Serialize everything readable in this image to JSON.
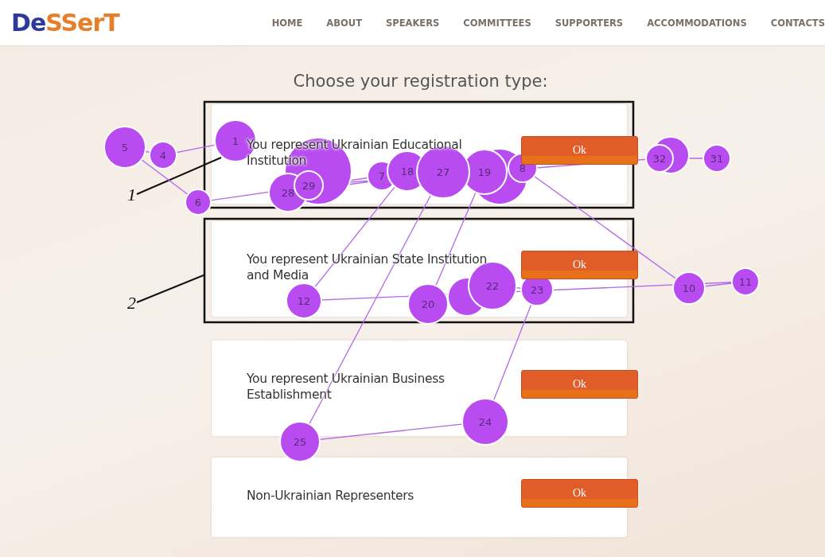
{
  "logo": {
    "part_1": "De",
    "part_2": "SSerT"
  },
  "nav": [
    "HOME",
    "ABOUT",
    "SPEAKERS",
    "COMMITTEES",
    "SUPPORTERS",
    "ACCOMMODATIONS",
    "CONTACTS"
  ],
  "heading": "Choose your registration type:",
  "cards": [
    {
      "text": "You represent Ukrainian Educational Institution",
      "button": "Ok"
    },
    {
      "text": "You represent Ukrainian State Institution and Media",
      "button": "Ok"
    },
    {
      "text": "You represent Ukrainian Business Establishment",
      "button": "Ok"
    },
    {
      "text": "Non-Ukrainian Representers",
      "button": "Ok"
    }
  ],
  "annotations": [
    {
      "label": "1"
    },
    {
      "label": "2"
    }
  ],
  "fixations": [
    {
      "label": "1"
    },
    {
      "label": "4"
    },
    {
      "label": "5"
    },
    {
      "label": "6"
    },
    {
      "label": "7"
    },
    {
      "label": "8"
    },
    {
      "label": "10"
    },
    {
      "label": "11"
    },
    {
      "label": "12"
    },
    {
      "label": "18"
    },
    {
      "label": "19"
    },
    {
      "label": "20"
    },
    {
      "label": "22"
    },
    {
      "label": "23"
    },
    {
      "label": "24"
    },
    {
      "label": "25"
    },
    {
      "label": "27"
    },
    {
      "label": "28"
    },
    {
      "label": "29"
    },
    {
      "label": "32"
    },
    {
      "label": "31"
    }
  ]
}
